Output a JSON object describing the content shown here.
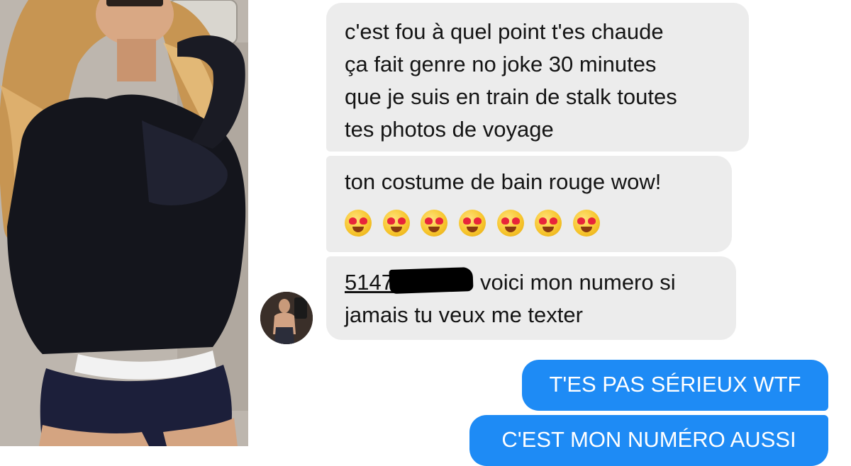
{
  "conversation": {
    "messages": [
      {
        "direction": "incoming",
        "lines": [
          "c'est fou à quel point t'es chaude",
          "ça fait genre no joke 30 minutes",
          "que je suis en train de stalk toutes",
          "tes photos de voyage"
        ]
      },
      {
        "direction": "incoming",
        "lines": [
          "ton costume de bain rouge wow!"
        ],
        "emoji": {
          "name": "heart-eyes-emoji",
          "count": 7
        }
      },
      {
        "direction": "incoming",
        "phone_prefix": "5147",
        "phone_suffix_redacted": true,
        "after_phone": "voici mon numero si",
        "lines": [
          "jamais tu veux me texter"
        ]
      },
      {
        "direction": "outgoing",
        "text": "T'ES PAS SÉRIEUX WTF"
      },
      {
        "direction": "outgoing",
        "text": "C'EST MON NUMÉRO AUSSI"
      }
    ]
  },
  "colors": {
    "incoming_bubble": "#ececec",
    "outgoing_bubble": "#1e8bf5",
    "text_dark": "#141414",
    "text_light": "#ffffff",
    "redaction": "#000000"
  },
  "icons": {
    "sender_avatar": "avatar",
    "selfie_photo": "photo",
    "emoji": "heart-eyes-emoji"
  }
}
